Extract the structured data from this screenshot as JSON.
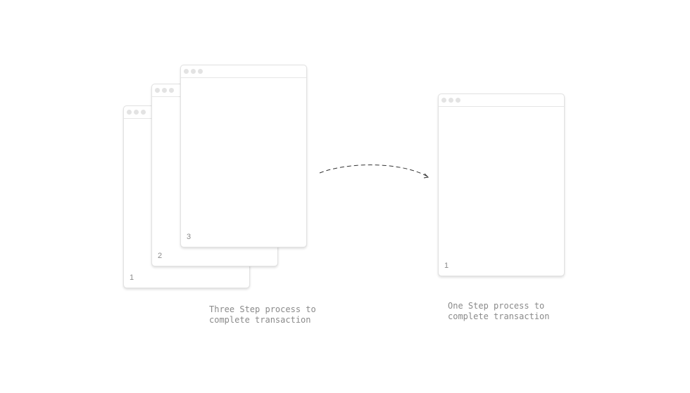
{
  "left_group": {
    "windows": [
      {
        "number": "1"
      },
      {
        "number": "2"
      },
      {
        "number": "3"
      }
    ],
    "caption_line1": "Three Step process to",
    "caption_line2": "complete transaction"
  },
  "right_group": {
    "window": {
      "number": "1"
    },
    "caption_line1": "One Step process to",
    "caption_line2": "complete transaction"
  },
  "colors": {
    "window_border": "#e2e2e2",
    "dot": "#e3e3e3",
    "caption": "#8a8a8a",
    "arrow": "#333333"
  }
}
